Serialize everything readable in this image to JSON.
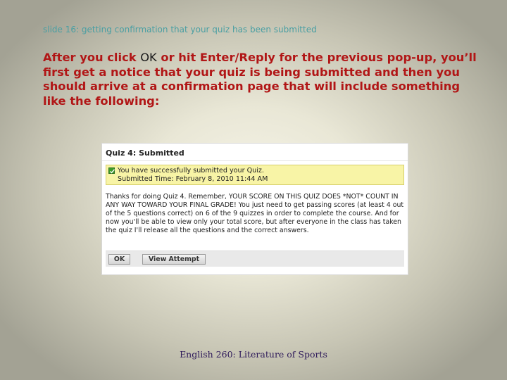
{
  "slide": {
    "title": "slide 16: getting confirmation that your quiz has been submitted",
    "intro_before": "After you click ",
    "intro_ok": "OK",
    "intro_after": " or hit Enter/Reply for the previous pop-up, you’ll first get a notice that your quiz is being submitted and then you should arrive at a confirmation page that will include something like the following:",
    "footer": "English 260: Literature of Sports"
  },
  "screenshot": {
    "header": "Quiz 4: Submitted",
    "notice_line1": "You have successfully submitted your Quiz.",
    "notice_line2": "Submitted Time: February 8, 2010 11:44 AM",
    "message": "Thanks for doing Quiz 4. Remember, YOUR SCORE ON THIS QUIZ DOES *NOT* COUNT IN ANY WAY TOWARD YOUR FINAL GRADE! You just need to get passing scores (at least 4 out of the 5 questions correct) on 6 of the 9 quizzes in order to complete the course. And for now you'll be able to view only your total score, but after everyone in the class has taken the quiz I'll release all the questions and the correct answers.",
    "ok_button": "OK",
    "view_attempt_button": "View Attempt",
    "check_icon": "checkbox-check-icon"
  },
  "colors": {
    "heading_red": "#b11616",
    "title_teal": "#4a9fa3",
    "notice_yellow": "#f8f4a6",
    "footer_purple": "#2e1a5a"
  }
}
